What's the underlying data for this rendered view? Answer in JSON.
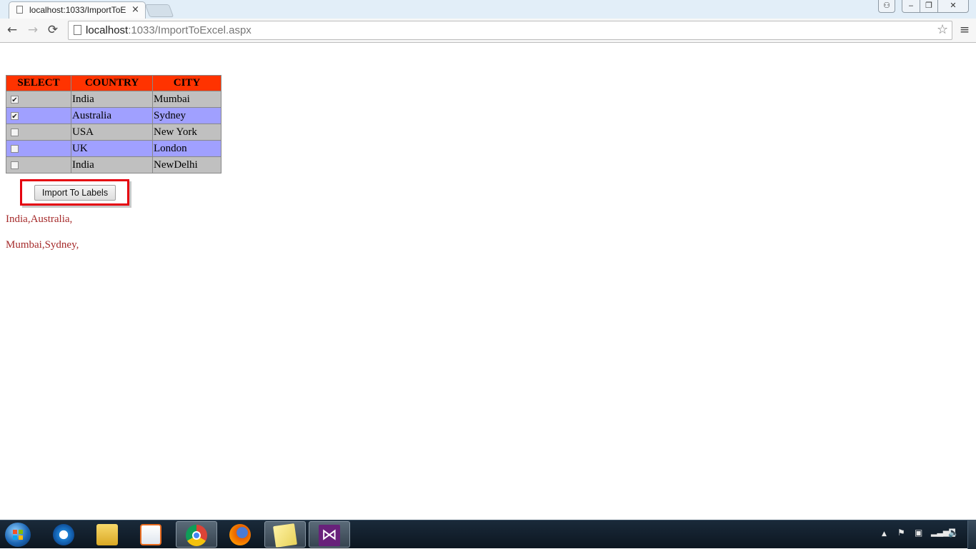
{
  "browser": {
    "tab_title": "localhost:1033/ImportToE",
    "tab_close": "×",
    "url_host": "localhost",
    "url_path": ":1033/ImportToExcel.aspx",
    "back": "←",
    "forward": "→",
    "reload": "⟳",
    "star": "☆",
    "menu": "≡",
    "win_user": "⚇",
    "win_min": "‒",
    "win_max": "❐",
    "win_close": "✕"
  },
  "grid": {
    "headers": [
      "SELECT",
      "COUNTRY",
      "CITY"
    ],
    "rows": [
      {
        "checked": "✔",
        "country": "India",
        "city": "Mumbai"
      },
      {
        "checked": "✔",
        "country": "Australia",
        "city": "Sydney"
      },
      {
        "checked": "",
        "country": "USA",
        "city": "New York"
      },
      {
        "checked": "",
        "country": "UK",
        "city": "London"
      },
      {
        "checked": "",
        "country": "India",
        "city": "NewDelhi"
      }
    ],
    "header_color": "#ff3300",
    "row_colors": [
      "#c0c0c0",
      "#a0a0ff"
    ]
  },
  "import_button": {
    "label": "Import To Labels",
    "highlight_color": "#e5000f"
  },
  "output": {
    "countries": "India,Australia,",
    "cities": "Mumbai,Sydney,",
    "color": "#a52a2a"
  },
  "taskbar": {
    "items": [
      "ie-icon",
      "explorer-icon",
      "media-player-icon",
      "chrome-icon",
      "firefox-icon",
      "sticky-notes-icon",
      "visual-studio-icon"
    ],
    "tray": {
      "arrow": "▲",
      "flag": "⚑",
      "device": "▣",
      "signal": "▂▃▅▇",
      "volume": "🔈"
    }
  }
}
